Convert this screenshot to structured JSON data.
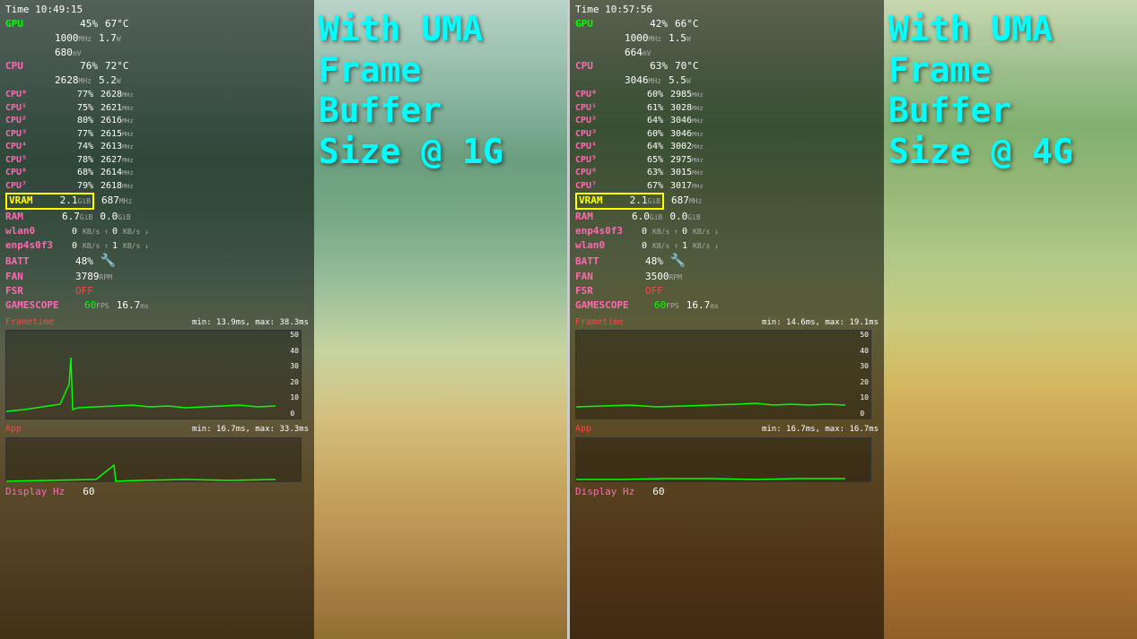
{
  "left": {
    "title": "With UMA",
    "subtitle": "Frame\nBuffer\nSize @ 1G",
    "time": "Time  10:49:15",
    "gpu": {
      "label": "GPU",
      "pct": "45%",
      "temp": "67°C",
      "freq": "1000",
      "mv": "680"
    },
    "cpu": {
      "label": "CPU",
      "pct": "76%",
      "temp": "72°C",
      "freq": "2628"
    },
    "cores": [
      {
        "label": "CPU⁰",
        "pct": "77%",
        "freq": "2628"
      },
      {
        "label": "CPU¹",
        "pct": "75%",
        "freq": "2621"
      },
      {
        "label": "CPU²",
        "pct": "80%",
        "freq": "2616"
      },
      {
        "label": "CPU³",
        "pct": "77%",
        "freq": "2615"
      },
      {
        "label": "CPU⁴",
        "pct": "74%",
        "freq": "2613"
      },
      {
        "label": "CPU⁵",
        "pct": "78%",
        "freq": "2627"
      },
      {
        "label": "CPU⁶",
        "pct": "68%",
        "freq": "2614"
      },
      {
        "label": "CPU⁷",
        "pct": "79%",
        "freq": "2618"
      }
    ],
    "vram": {
      "label": "VRAM",
      "val": "2.1",
      "unit": "GiB",
      "freq": "687"
    },
    "ram": {
      "label": "RAM",
      "val": "6.7",
      "unit": "GiB",
      "other": "0.0"
    },
    "net1": {
      "label": "wlan0",
      "up": "0",
      "down": "0"
    },
    "net2": {
      "label": "enp4s0f3",
      "up": "0",
      "down": "1"
    },
    "batt": {
      "label": "BATT",
      "val": "48%"
    },
    "fan": {
      "label": "FAN",
      "val": "3789"
    },
    "fsr": {
      "label": "FSR",
      "val": "OFF"
    },
    "gamescope": {
      "label": "GAMESCOPE",
      "fps": "60",
      "ms": "16.7"
    },
    "frametime": {
      "label": "Frametime",
      "min": "13.9ms",
      "max": "38.3ms"
    },
    "app": {
      "label": "App",
      "min": "16.7ms",
      "max": "33.3ms"
    },
    "display_hz": {
      "label": "Display Hz",
      "val": "60"
    }
  },
  "right": {
    "title": "With UMA",
    "subtitle": "Frame\nBuffer\nSize @ 4G",
    "time": "Time  10:57:56",
    "gpu": {
      "label": "GPU",
      "pct": "42%",
      "temp": "66°C",
      "freq": "1000",
      "mv": "664"
    },
    "cpu": {
      "label": "CPU",
      "pct": "63%",
      "temp": "70°C",
      "freq": "3046"
    },
    "cores": [
      {
        "label": "CPU⁰",
        "pct": "60%",
        "freq": "2985"
      },
      {
        "label": "CPU¹",
        "pct": "61%",
        "freq": "3028"
      },
      {
        "label": "CPU²",
        "pct": "64%",
        "freq": "3046"
      },
      {
        "label": "CPU³",
        "pct": "60%",
        "freq": "3046"
      },
      {
        "label": "CPU⁴",
        "pct": "64%",
        "freq": "3002"
      },
      {
        "label": "CPU⁵",
        "pct": "65%",
        "freq": "2975"
      },
      {
        "label": "CPU⁶",
        "pct": "63%",
        "freq": "3015"
      },
      {
        "label": "CPU⁷",
        "pct": "67%",
        "freq": "3017"
      }
    ],
    "vram": {
      "label": "VRAM",
      "val": "2.1",
      "unit": "GiB",
      "freq": "687"
    },
    "ram": {
      "label": "RAM",
      "val": "6.0",
      "unit": "GiB",
      "other": "0.0"
    },
    "net1": {
      "label": "enp4s0f3",
      "up": "0",
      "down": "0"
    },
    "net2": {
      "label": "wlan0",
      "up": "0",
      "down": "1"
    },
    "batt": {
      "label": "BATT",
      "val": "48%"
    },
    "fan": {
      "label": "FAN",
      "val": "3500"
    },
    "fsr": {
      "label": "FSR",
      "val": "OFF"
    },
    "gamescope": {
      "label": "GAMESCOPE",
      "fps": "60",
      "ms": "16.7"
    },
    "frametime": {
      "label": "Frametime",
      "min": "14.6ms",
      "max": "19.1ms"
    },
    "app": {
      "label": "App",
      "min": "16.7ms",
      "max": "16.7ms"
    },
    "display_hz": {
      "label": "Display Hz",
      "val": "60"
    }
  }
}
